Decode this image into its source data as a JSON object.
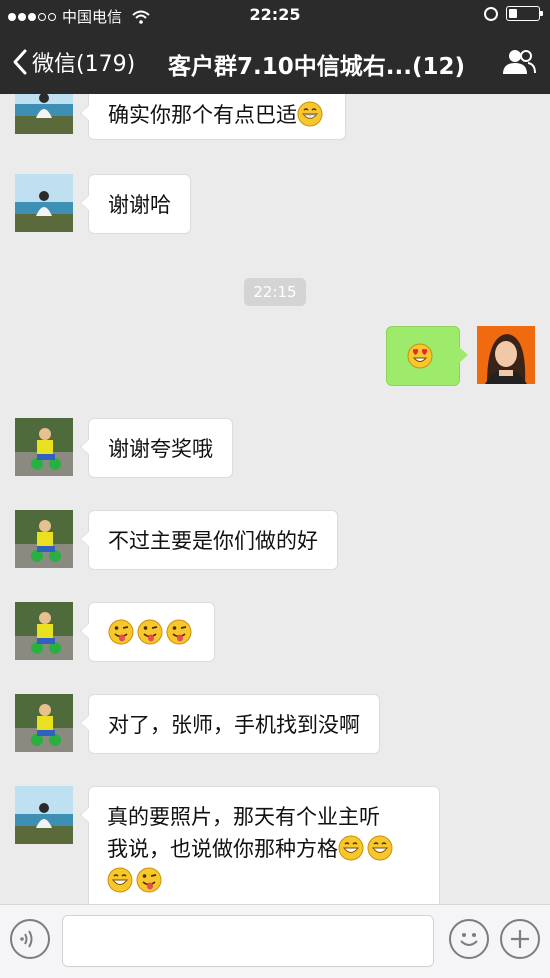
{
  "status_bar": {
    "carrier": "中国电信",
    "time": "22:25"
  },
  "nav": {
    "back_label": "微信(179)",
    "title": "客户群7.10中信城右...(12)"
  },
  "messages": [
    {
      "side": "left",
      "avatar": "beach-avatar-icon",
      "text": "确实你那个有点巴适",
      "emojis": [
        "grin"
      ]
    },
    {
      "side": "left",
      "avatar": "beach-avatar-icon",
      "text": "谢谢哈",
      "emojis": []
    },
    {
      "time": "22:15"
    },
    {
      "side": "right",
      "avatar": "woman-avatar-icon",
      "text": "",
      "emojis": [
        "heart-eyes"
      ]
    },
    {
      "side": "left",
      "avatar": "child-avatar-icon",
      "text": "谢谢夸奖哦",
      "emojis": []
    },
    {
      "side": "left",
      "avatar": "child-avatar-icon",
      "text": "不过主要是你们做的好",
      "emojis": []
    },
    {
      "side": "left",
      "avatar": "child-avatar-icon",
      "text": "",
      "emojis": [
        "wink-tongue",
        "wink-tongue",
        "wink-tongue"
      ]
    },
    {
      "side": "left",
      "avatar": "child-avatar-icon",
      "text": "对了，张师，手机找到没啊",
      "emojis": []
    },
    {
      "side": "left",
      "avatar": "beach-avatar-icon",
      "text_line1": "真的要照片，那天有个业主听",
      "text_line2": "我说，也说做你那种方格",
      "emojis": [
        "grin",
        "grin",
        "grin",
        "wink-tongue"
      ]
    }
  ],
  "input": {
    "value": "",
    "placeholder": ""
  },
  "colors": {
    "nav_bg": "#2b2b2b",
    "chat_bg": "#ebebeb",
    "sent_bubble": "#9eea6a",
    "received_bubble": "#ffffff"
  }
}
